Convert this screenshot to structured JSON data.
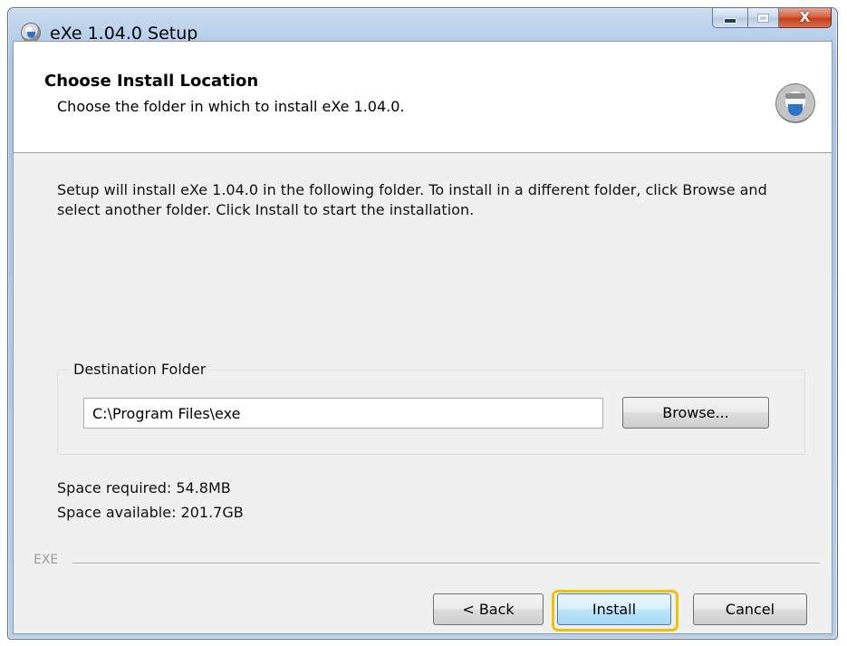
{
  "window": {
    "title": "eXe 1.04.0 Setup",
    "close_glyph": "X"
  },
  "header": {
    "title": "Choose Install Location",
    "subtitle": "Choose the folder in which to install eXe 1.04.0."
  },
  "body": {
    "description": "Setup will install eXe 1.04.0 in the following folder. To install in a different folder, click Browse and select another folder. Click Install to start the installation."
  },
  "destination": {
    "legend": "Destination Folder",
    "path": "C:\\Program Files\\exe",
    "browse_label": "Browse..."
  },
  "space": {
    "required": "Space required: 54.8MB",
    "available": "Space available: 201.7GB"
  },
  "footer": {
    "brand": "EXE",
    "back_label": "< Back",
    "install_label": "Install",
    "cancel_label": "Cancel"
  },
  "colors": {
    "highlight": "#f2c200",
    "accent": "#3c7fb1"
  },
  "icons": [
    "setup-app-icon",
    "installer-disc-icon",
    "minimize-icon",
    "maximize-icon",
    "close-icon"
  ]
}
